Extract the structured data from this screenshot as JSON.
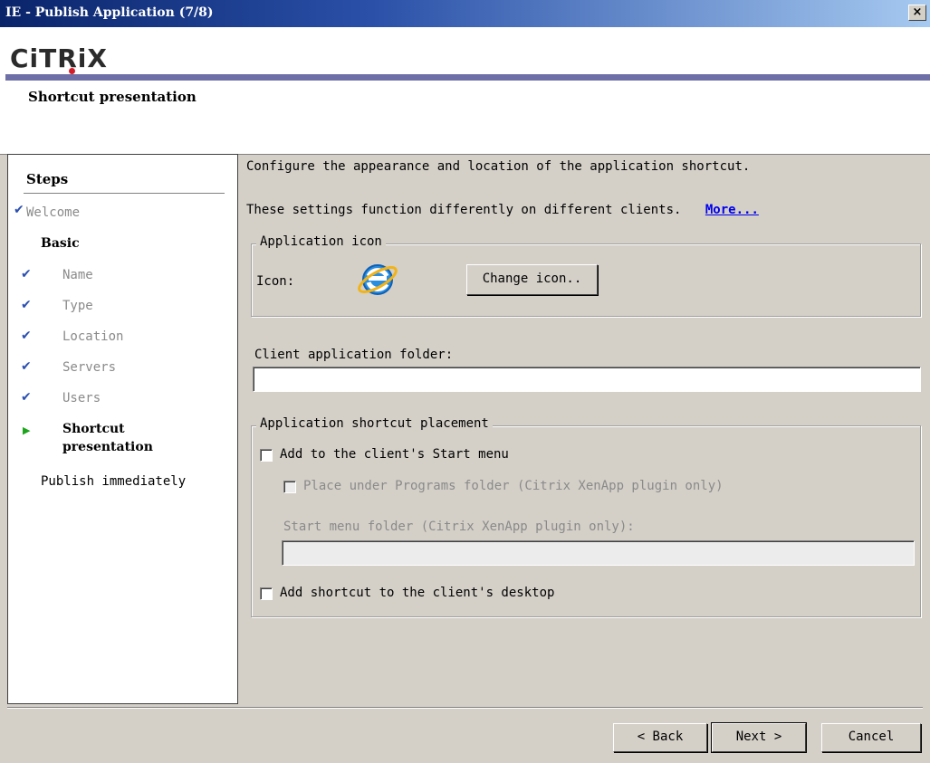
{
  "window": {
    "title": "IE - Publish Application (7/8)",
    "close_glyph": "×"
  },
  "header": {
    "logo_text": "CiTRiX",
    "subtitle": "Shortcut presentation"
  },
  "steps": {
    "title": "Steps",
    "items": [
      {
        "label": "Welcome",
        "state": "done"
      },
      {
        "label": "Basic",
        "state": "group"
      },
      {
        "label": "Name",
        "state": "done"
      },
      {
        "label": "Type",
        "state": "done"
      },
      {
        "label": "Location",
        "state": "done"
      },
      {
        "label": "Servers",
        "state": "done"
      },
      {
        "label": "Users",
        "state": "done"
      },
      {
        "label": "Shortcut",
        "label2": "presentation",
        "state": "current"
      },
      {
        "label": "Publish immediately",
        "state": "pending"
      }
    ],
    "check_glyph": "✔",
    "arrow_glyph": "▶"
  },
  "main": {
    "description": "Configure the appearance and location of the application shortcut.",
    "note": "These settings function differently on different clients.",
    "more_link": "More...",
    "icon_group": {
      "legend": "Application icon",
      "icon_label": "Icon:",
      "icon_name": "internet-explorer-icon",
      "change_button": "Change icon.."
    },
    "client_folder": {
      "label": "Client application folder:",
      "value": ""
    },
    "placement_group": {
      "legend": "Application shortcut placement",
      "start_menu_checkbox": "Add to the client's Start menu",
      "programs_folder_checkbox": "Place under Programs folder (Citrix XenApp plugin only)",
      "start_menu_folder_label": "Start menu folder (Citrix XenApp plugin only):",
      "start_menu_folder_value": "",
      "desktop_checkbox": "Add shortcut to the client's desktop"
    }
  },
  "footer": {
    "back_button": "< Back",
    "next_button": "Next >",
    "cancel_button": "Cancel"
  },
  "colors": {
    "accent_bar": "#6f6fa8",
    "check": "#2a4fb0",
    "current_arrow": "#1aa51a",
    "link": "#0000ee"
  }
}
